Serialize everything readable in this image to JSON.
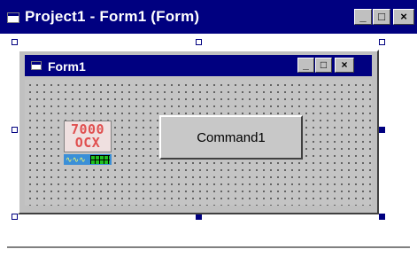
{
  "outer_window": {
    "title": "Project1 - Form1 (Form)",
    "buttons": {
      "minimize": "_",
      "maximize": "□",
      "close": "×"
    }
  },
  "form": {
    "title": "Form1",
    "buttons": {
      "minimize": "_",
      "maximize": "□",
      "close": "×"
    }
  },
  "controls": {
    "ocx": {
      "text": "7000\nOCX"
    },
    "command_button": {
      "label": "Command1"
    }
  },
  "colors": {
    "titlebar": "#000080",
    "face": "#c0c0c0",
    "handle": "#000080"
  },
  "icons": [
    "window-icon",
    "minimize-icon",
    "maximize-icon",
    "close-icon"
  ]
}
